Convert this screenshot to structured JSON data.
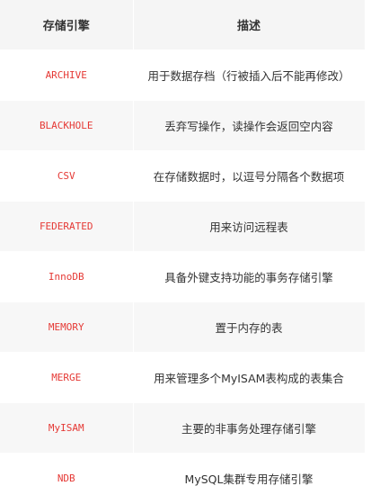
{
  "table": {
    "headers": {
      "engine": "存储引擎",
      "description": "描述"
    },
    "rows": [
      {
        "engine": "ARCHIVE",
        "description": "用于数据存档（行被插入后不能再修改）"
      },
      {
        "engine": "BLACKHOLE",
        "description": "丢弃写操作，读操作会返回空内容"
      },
      {
        "engine": "CSV",
        "description": "在存储数据时，以逗号分隔各个数据项"
      },
      {
        "engine": "FEDERATED",
        "description": "用来访问远程表"
      },
      {
        "engine": "InnoDB",
        "description": "具备外键支持功能的事务存储引擎"
      },
      {
        "engine": "MEMORY",
        "description": "置于内存的表"
      },
      {
        "engine": "MERGE",
        "description": "用来管理多个MyISAM表构成的表集合"
      },
      {
        "engine": "MyISAM",
        "description": "主要的非事务处理存储引擎"
      },
      {
        "engine": "NDB",
        "description": "MySQL集群专用存储引擎"
      }
    ]
  },
  "colors": {
    "engine_text": "#e53935",
    "header_bg": "#f5f5f5",
    "stripe_bg": "#f7f7f7"
  }
}
